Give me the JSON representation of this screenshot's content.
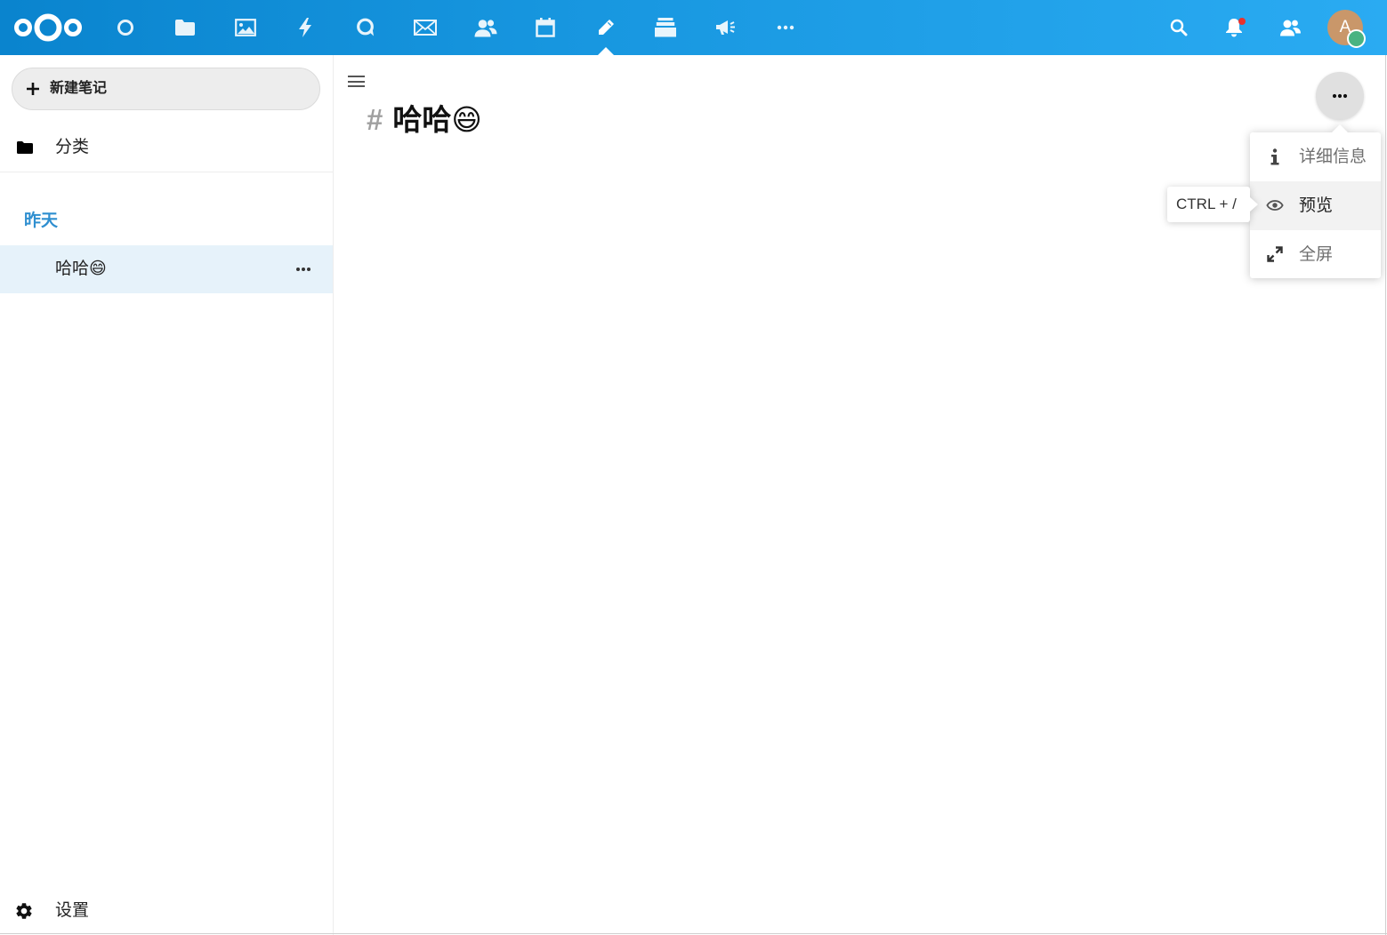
{
  "header": {
    "logo_icon": "nextcloud-logo",
    "apps": [
      {
        "icon": "dashboard-icon"
      },
      {
        "icon": "files-folder-icon"
      },
      {
        "icon": "photos-icon"
      },
      {
        "icon": "activity-lightning-icon"
      },
      {
        "icon": "talk-icon"
      },
      {
        "icon": "mail-icon"
      },
      {
        "icon": "contacts-icon"
      },
      {
        "icon": "calendar-icon"
      },
      {
        "icon": "notes-pencil-icon",
        "active": true
      },
      {
        "icon": "deck-icon"
      },
      {
        "icon": "announcements-megaphone-icon"
      },
      {
        "icon": "more-apps-icon"
      }
    ],
    "right_icons": [
      "search-icon",
      "notifications-bell-icon",
      "contacts-menu-icon"
    ],
    "notifications_unread": true,
    "avatar": {
      "initial": "A",
      "status": "online"
    }
  },
  "sidebar": {
    "new_note_label": "新建笔记",
    "new_note_icon": "plus-icon",
    "categories_label": "分类",
    "categories_icon": "folder-icon",
    "group_heading": "昨天",
    "notes": [
      {
        "title": "哈哈😄",
        "selected": true,
        "menu_icon": "more-icon"
      }
    ],
    "settings_label": "设置",
    "settings_icon": "gear-icon"
  },
  "editor": {
    "heading_marker": "#",
    "title": "哈哈😄"
  },
  "actions_menu": {
    "open": true,
    "trigger_icon": "more-icon",
    "items": [
      {
        "label": "详细信息",
        "icon": "info-icon"
      },
      {
        "label": "预览",
        "icon": "eye-icon",
        "hovered": true
      },
      {
        "label": "全屏",
        "icon": "fullscreen-icon"
      }
    ],
    "tooltip": "CTRL + /"
  },
  "colors": {
    "header_gradient_start": "#0a84ce",
    "header_gradient_end": "#2aabf2",
    "primary": "#2f8fd0",
    "selected_note_bg": "#e6f2fa",
    "notification_dot": "#e9322d",
    "status_online": "#49b382",
    "avatar_bg": "#c9976a"
  }
}
